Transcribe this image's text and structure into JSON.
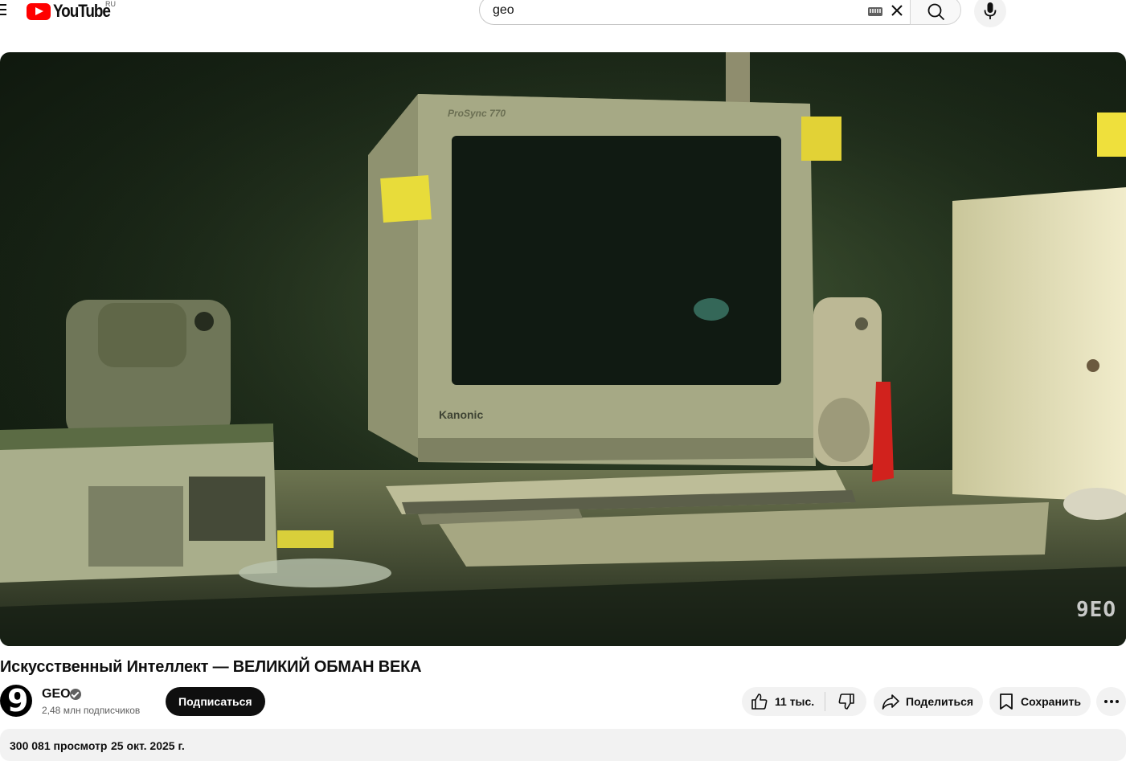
{
  "header": {
    "logo_text": "YouTube",
    "region": "RU",
    "search": {
      "value": "geo"
    }
  },
  "player": {
    "watermark": "9EO"
  },
  "video": {
    "title": "Искусственный Интеллект — ВЕЛИКИЙ ОБМАН ВЕКА",
    "channel": {
      "name": "GEO",
      "avatar_letter": "9",
      "subscribers": "2,48 млн подписчиков"
    },
    "subscribe_label": "Подписаться",
    "likes": "11 тыс.",
    "share_label": "Поделиться",
    "save_label": "Сохранить",
    "views": "300 081 просмотр",
    "date": "25 окт. 2025 г."
  },
  "icons": {
    "menu": "hamburger-icon",
    "keyboard": "keyboard-icon",
    "clear": "close-icon",
    "search": "search-icon",
    "mic": "microphone-icon",
    "verified": "verified-check-icon",
    "like": "thumbs-up-icon",
    "dislike": "thumbs-down-icon",
    "share": "share-arrow-icon",
    "save": "bookmark-icon",
    "more": "more-horizontal-icon"
  },
  "colors": {
    "brand_red": "#ff0000",
    "subscribe_bg": "#0f0f0f",
    "pill_bg": "#f2f2f2"
  }
}
